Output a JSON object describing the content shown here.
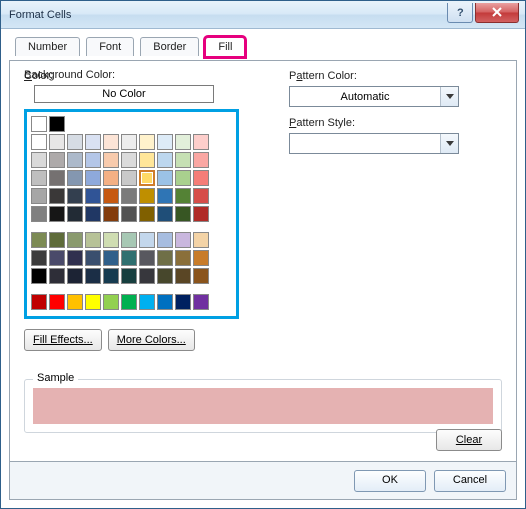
{
  "window": {
    "title": "Format Cells"
  },
  "tabs": {
    "number": "Number",
    "font": "Font",
    "border": "Border",
    "fill": "Fill",
    "active": "fill"
  },
  "labels": {
    "bg_color": "Background Color:",
    "no_color": "No Color",
    "pattern_color": "Pattern Color:",
    "pattern_style": "Pattern Style:",
    "sample": "Sample"
  },
  "buttons": {
    "fill_effects": "Fill Effects...",
    "more_colors": "More Colors...",
    "clear": "Clear",
    "ok": "OK",
    "cancel": "Cancel"
  },
  "pattern_color_value": "Automatic",
  "pattern_style_value": "",
  "sample_color": "#e5b2b2",
  "selected_swatch": {
    "row": 3,
    "col": 6
  },
  "palette": {
    "row0": [
      "#ffffff",
      "#000000"
    ],
    "row1": [
      "#ffffff",
      "#e7e6e6",
      "#d6dce4",
      "#d9e1f2",
      "#fce4d6",
      "#ededed",
      "#fff2cc",
      "#ddebf7",
      "#e2efda",
      "#fdcecb"
    ],
    "row2": [
      "#d9d9d9",
      "#aeaaaa",
      "#acb9ca",
      "#b4c6e7",
      "#f8cbad",
      "#dbdbdb",
      "#ffe699",
      "#bdd7ee",
      "#c6e0b4",
      "#faa7a3"
    ],
    "row3": [
      "#bfbfbf",
      "#757171",
      "#8497b0",
      "#8ea9db",
      "#f4b084",
      "#c9c9c9",
      "#ffd966",
      "#9bc2e6",
      "#a9d08e",
      "#f57d78"
    ],
    "row4": [
      "#a6a6a6",
      "#3a3838",
      "#333f4f",
      "#305496",
      "#c65911",
      "#7b7b7b",
      "#bf8f00",
      "#2f75b5",
      "#548235",
      "#d64d49"
    ],
    "row5": [
      "#808080",
      "#161616",
      "#222b35",
      "#203764",
      "#833c0c",
      "#525252",
      "#806000",
      "#1f4e78",
      "#375623",
      "#b02b27"
    ],
    "row8": [
      "#7c8a54",
      "#5e6b3a",
      "#8a9a6e",
      "#b7c297",
      "#cfddb2",
      "#a7c8b4",
      "#c3d7ec",
      "#a7bde0",
      "#c9b7de",
      "#f3d3a6"
    ],
    "row9": [
      "#3b3b3b",
      "#4a4a6a",
      "#30304f",
      "#3a4f6e",
      "#2f5f8a",
      "#2f6f6f",
      "#58585f",
      "#6f6f47",
      "#8a6f3a",
      "#c87c2a"
    ],
    "row10": [
      "#000000",
      "#2e2e38",
      "#1c2334",
      "#1b2e46",
      "#163b50",
      "#173f3f",
      "#37373d",
      "#47472c",
      "#5a4625",
      "#8a541c"
    ],
    "standard": [
      "#c00000",
      "#ff0000",
      "#ffc000",
      "#ffff00",
      "#92d050",
      "#00b050",
      "#00b0f0",
      "#0070c0",
      "#002060",
      "#7030a0"
    ]
  }
}
